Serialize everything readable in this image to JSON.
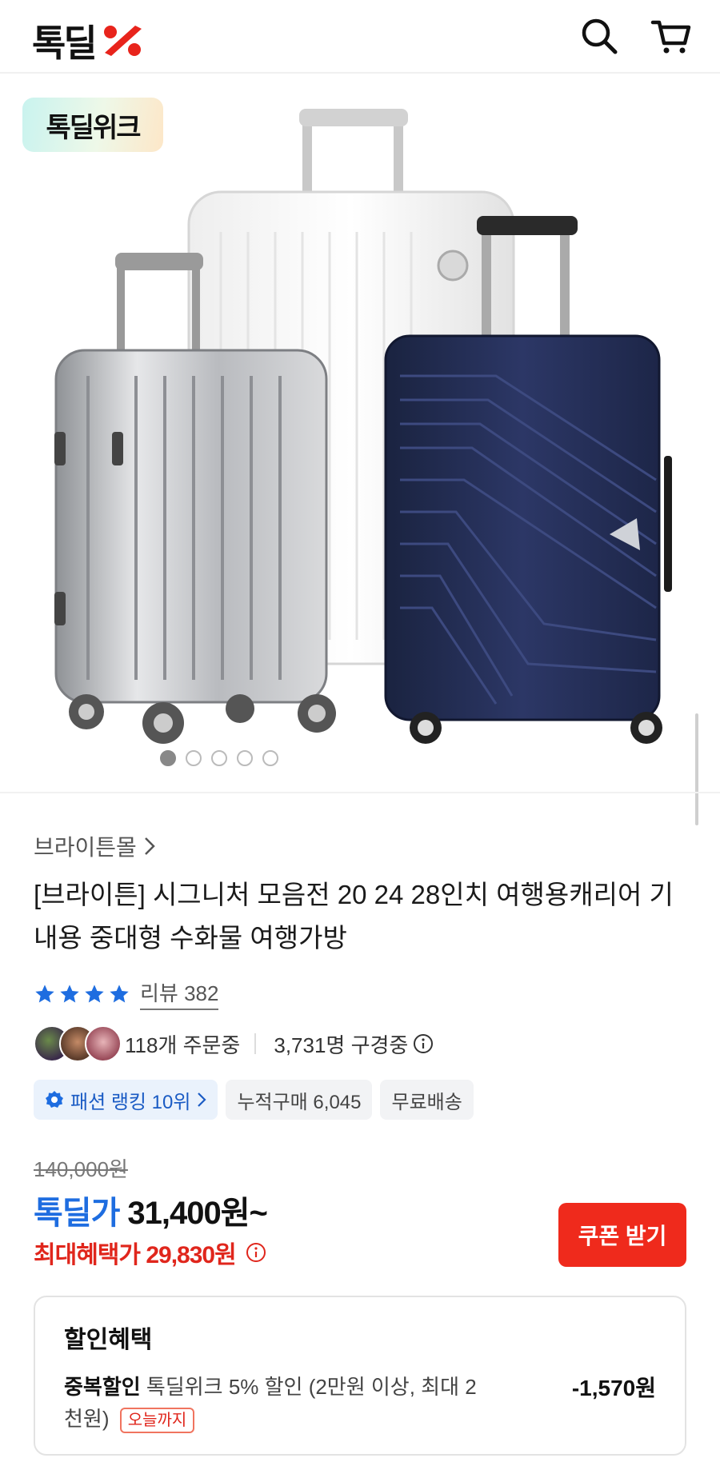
{
  "header": {
    "logo_text": "톡딜",
    "logo_mark_color": "#e8241c",
    "search_icon": "search-icon",
    "cart_icon": "cart-icon"
  },
  "hero": {
    "badge_label": "톡딜위크",
    "image_description": "three suitcases: silver, white, navy",
    "carousel_total": 5,
    "carousel_active": 1
  },
  "product": {
    "store": "브라이튼몰",
    "title": "[브라이튼] 시그니처 모음전 20 24 28인치 여행용캐리어 기내용 중대형 수화물 여행가방",
    "rating_stars": 4,
    "review_label": "리뷰 382",
    "orders_text": "118개 주문중",
    "viewers_text": "3,731명 구경중",
    "chips": {
      "rank": "패션 랭킹 10위",
      "cumulative": "누적구매 6,045",
      "shipping": "무료배송"
    }
  },
  "pricing": {
    "original": "140,000원",
    "deal_label": "톡딜가",
    "deal_price": "31,400원~",
    "max_benefit": "최대혜택가 29,830원",
    "coupon_button": "쿠폰 받기",
    "accent_blue": "#1e6de0",
    "accent_red": "#e0261c"
  },
  "benefit": {
    "title": "할인혜택",
    "label": "중복할인",
    "desc": "톡딜위크 5% 할인 (2만원 이상, 최대 2천원)",
    "tag": "오늘까지",
    "amount": "-1,570원"
  }
}
